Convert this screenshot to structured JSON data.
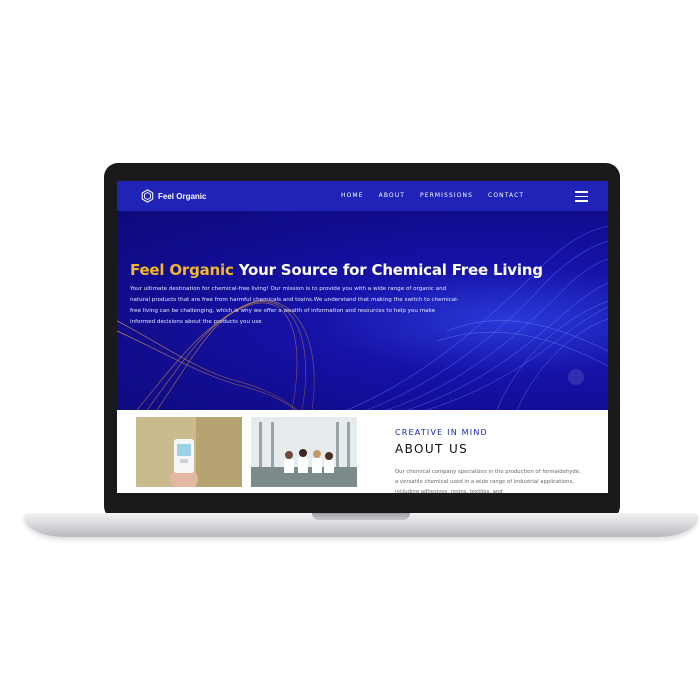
{
  "header": {
    "logo_text": "Feel Organic",
    "nav": [
      "HOME",
      "ABOUT",
      "PERMISSIONS",
      "CONTACT"
    ]
  },
  "hero": {
    "title_accent": "Feel Organic",
    "title_rest": " Your Source for Chemical Free Living",
    "body": "Your ultimate destination for chemical-free living! Our mission is to provide you with a wide range of organic and natural products that are free from harmful chemicals and toxins.We understand that making the switch to chemical-free living can be challenging, which is why we offer a wealth of information and resources to help you make informed decisions about the products you use"
  },
  "about": {
    "eyebrow": "CREATIVE IN MIND",
    "title": "ABOUT US",
    "body": "Our chemical company specializes in the production of formaldehyde, a versatile chemical used in a wide range of industrial applications, including adhesives, resins, textiles, and"
  },
  "colors": {
    "header_bg": "#1f23b8",
    "hero_bg": "#120c8e",
    "accent": "#f1b730",
    "eyebrow": "#1f23b8"
  },
  "icons": {
    "logo": "hexagon-logo-icon",
    "menu": "hamburger-menu-icon"
  }
}
